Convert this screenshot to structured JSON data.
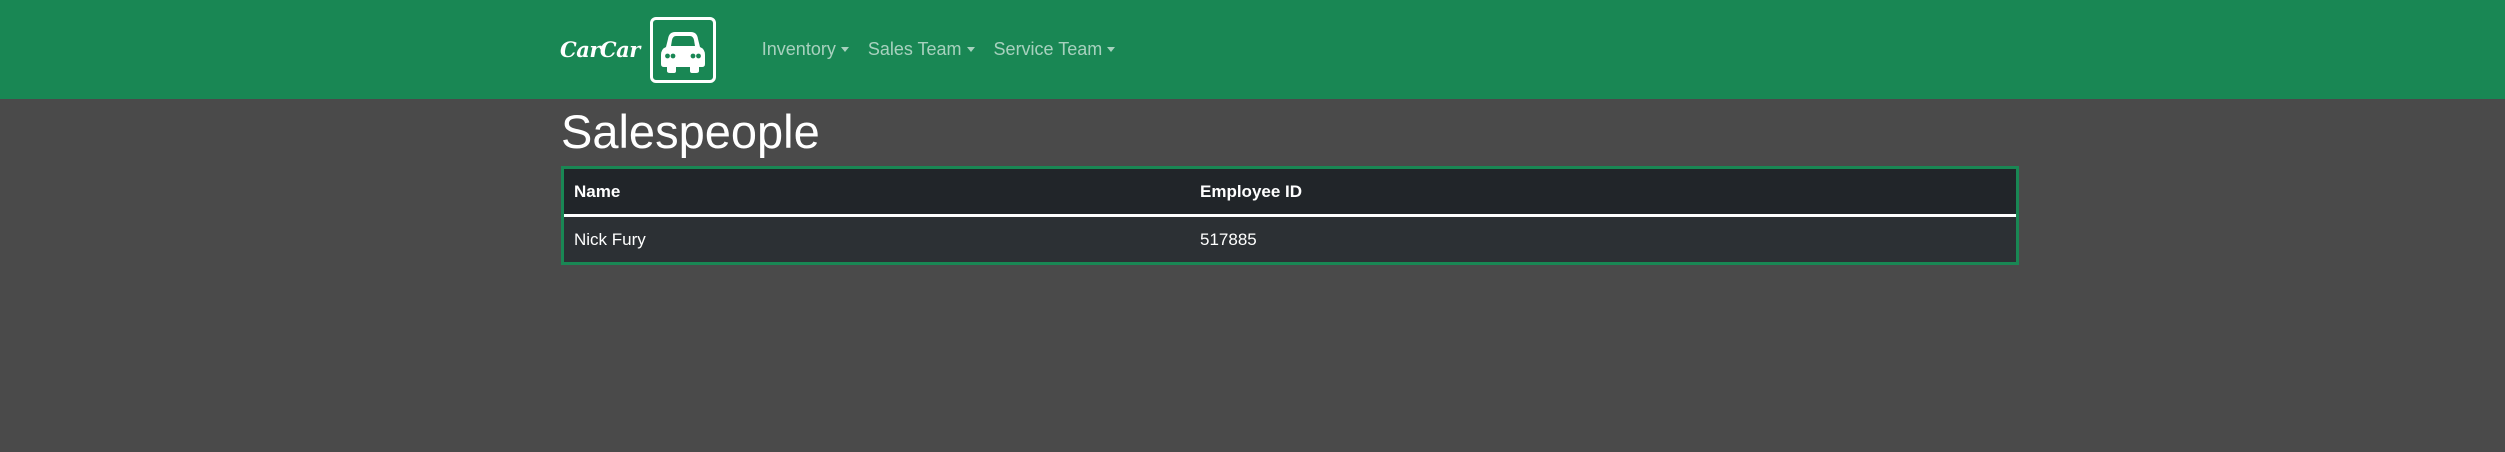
{
  "navbar": {
    "brand_text": "CarCar",
    "brand_icon": "car-icon",
    "items": [
      {
        "label": "Inventory"
      },
      {
        "label": "Sales Team"
      },
      {
        "label": "Service Team"
      }
    ]
  },
  "page": {
    "title": "Salespeople"
  },
  "table": {
    "headers": [
      "Name",
      "Employee ID"
    ],
    "rows": [
      {
        "name": "Nick Fury",
        "employee_id": "517885"
      }
    ]
  },
  "colors": {
    "navbar_bg": "#198754",
    "page_bg": "#4a4a4a",
    "table_header_bg": "#212529",
    "table_row_bg": "#2c3034",
    "table_border": "#198754"
  }
}
